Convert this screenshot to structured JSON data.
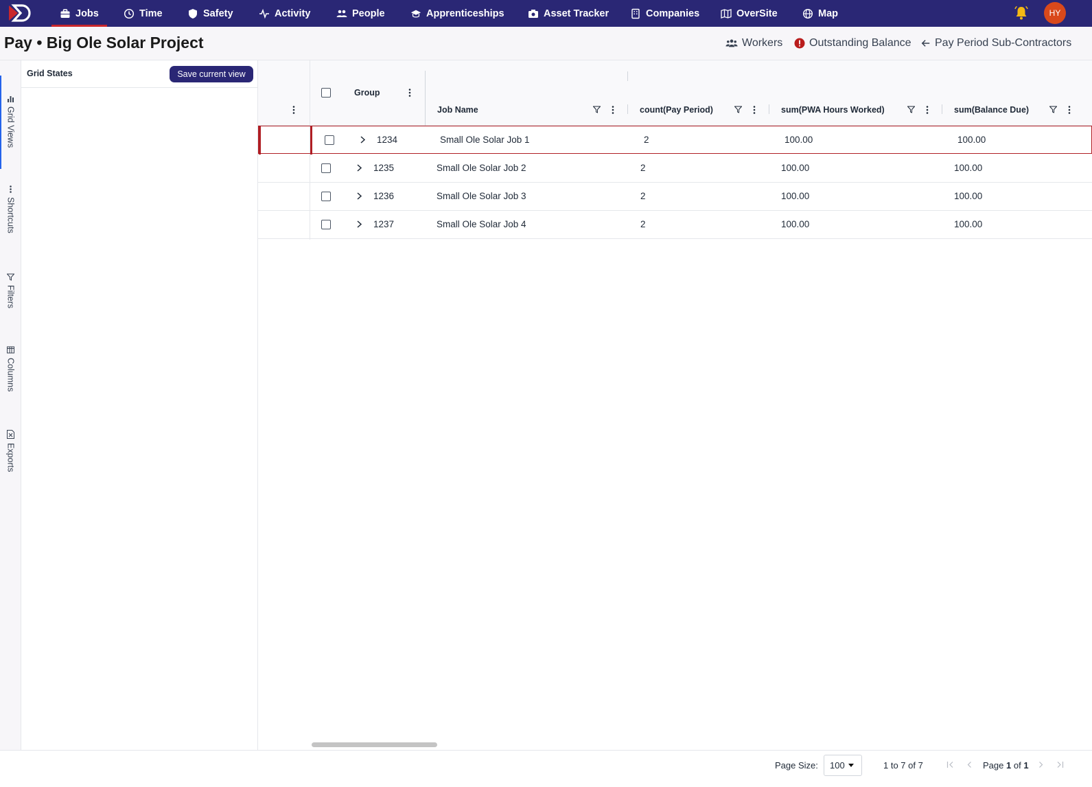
{
  "nav": {
    "items": [
      {
        "label": "Jobs",
        "icon": "briefcase-icon"
      },
      {
        "label": "Time",
        "icon": "clock-icon"
      },
      {
        "label": "Safety",
        "icon": "shield-icon"
      },
      {
        "label": "Activity",
        "icon": "activity-icon"
      },
      {
        "label": "People",
        "icon": "people-icon"
      },
      {
        "label": "Apprenticeships",
        "icon": "graduation-cap-icon"
      },
      {
        "label": "Asset Tracker",
        "icon": "camera-icon"
      },
      {
        "label": "Companies",
        "icon": "building-icon"
      },
      {
        "label": "OverSite",
        "icon": "map-icon"
      },
      {
        "label": "Map",
        "icon": "globe-icon"
      }
    ],
    "avatar_initials": "HY",
    "accent": "#2a2775",
    "active_underline": "#c9272c"
  },
  "header": {
    "title": "Pay • Big Ole Solar Project",
    "links": {
      "workers": "Workers",
      "outstanding": "Outstanding Balance",
      "back": "Pay Period Sub-Contractors"
    }
  },
  "rail": {
    "items": [
      "Grid Views",
      "Shortcuts",
      "Filters",
      "Columns",
      "Exports"
    ]
  },
  "panel": {
    "title": "Grid States",
    "save_label": "Save current view"
  },
  "grid": {
    "columns": {
      "group": "Group",
      "job_name": "Job Name",
      "count": "count(Pay Period)",
      "hours": "sum(PWA Hours Worked)",
      "balance": "sum(Balance Due)"
    },
    "rows": [
      {
        "group": "1234",
        "job_name": "Small Ole Solar Job 1",
        "count": "2",
        "hours": "100.00",
        "balance": "100.00"
      },
      {
        "group": "1235",
        "job_name": "Small Ole Solar Job 2",
        "count": "2",
        "hours": "100.00",
        "balance": "100.00"
      },
      {
        "group": "1236",
        "job_name": "Small Ole Solar Job 3",
        "count": "2",
        "hours": "100.00",
        "balance": "100.00"
      },
      {
        "group": "1237",
        "job_name": "Small Ole Solar Job 4",
        "count": "2",
        "hours": "100.00",
        "balance": "100.00"
      }
    ]
  },
  "footer": {
    "page_size_label": "Page Size:",
    "page_size_value": "100",
    "range_text": "1 to 7 of 7",
    "page_prefix": "Page",
    "page_current": "1",
    "page_of": "of",
    "page_total": "1"
  }
}
